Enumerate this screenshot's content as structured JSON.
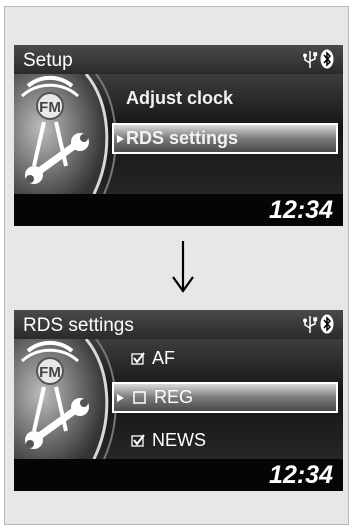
{
  "screen1": {
    "title": "Setup",
    "items": [
      {
        "label": "Adjust clock"
      },
      {
        "label": "RDS settings",
        "selected": true
      }
    ],
    "clock": "12:34"
  },
  "screen2": {
    "title": "RDS settings",
    "items": [
      {
        "label": "AF",
        "checked": true
      },
      {
        "label": "REG",
        "checked": false,
        "selected": true
      },
      {
        "label": "NEWS",
        "checked": true
      }
    ],
    "clock": "12:34"
  },
  "badge": {
    "text": "FM",
    "icon": "fm-radio-wrench-icon"
  },
  "status_icons": [
    "usb-icon",
    "bluetooth-icon"
  ],
  "transition": {
    "icon": "down-arrow-icon"
  }
}
